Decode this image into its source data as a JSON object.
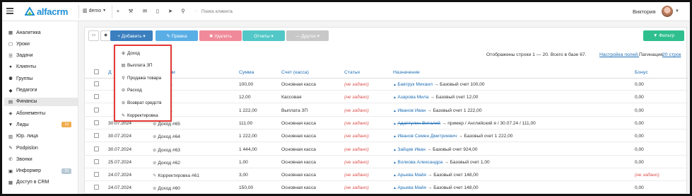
{
  "topbar": {
    "logo_text": "alfacrm",
    "branch": "demo",
    "search_placeholder": "Поиск клиента",
    "user_name": "Виктория",
    "brand_color": "#1f8fd6"
  },
  "sidebar": {
    "items": [
      {
        "label": "Аналитика",
        "icon": "chart-icon"
      },
      {
        "label": "Уроки",
        "icon": "calendar-icon"
      },
      {
        "label": "Задачи",
        "icon": "tasks-icon"
      },
      {
        "label": "Клиенты",
        "icon": "user-icon"
      },
      {
        "label": "Группы",
        "icon": "group-icon"
      },
      {
        "label": "Педагоги",
        "icon": "teacher-icon"
      },
      {
        "label": "Финансы",
        "icon": "money-icon",
        "active": true
      },
      {
        "label": "Абонементы",
        "icon": "ticket-icon"
      },
      {
        "label": "Лиды",
        "icon": "funnel-icon",
        "badge": "13"
      },
      {
        "label": "Юр. лица",
        "icon": "building-icon"
      },
      {
        "label": "Podpislon",
        "icon": "sign-icon"
      },
      {
        "label": "Звонки",
        "icon": "phone-icon"
      },
      {
        "label": "Информер",
        "icon": "info-icon",
        "badge": "15"
      },
      {
        "label": "Доступ в CRM",
        "icon": "lock-icon"
      }
    ]
  },
  "toolbar": {
    "add_label": "+ Добавить ▾",
    "edit_label": "✎ Правка",
    "delete_label": "✖ Удалить",
    "reports_label": "Отчеты ▾",
    "other_label": "— Другое ▾",
    "filter_label": "▼ Фильтр",
    "colors": {
      "add": "#3b7fbf",
      "edit": "#5aaee6",
      "delete": "#f08a9a",
      "reports": "#53c7c7",
      "other": "#c8c8c8",
      "filter": "#2fbf8f"
    }
  },
  "dropdown": {
    "items": [
      {
        "label": "Доход",
        "icon": "plus-circle-icon"
      },
      {
        "label": "Выплата ЗП",
        "icon": "cash-icon"
      },
      {
        "label": "Продажа товара",
        "icon": "cart-icon"
      },
      {
        "label": "Расход",
        "icon": "minus-circle-icon"
      },
      {
        "label": "Возврат средств",
        "icon": "minus-circle-icon"
      },
      {
        "label": "Корректировка",
        "icon": "pencil-icon"
      }
    ]
  },
  "info": {
    "shown_text": "Отображены строки 1 — 20. Всего в базе 67.",
    "settings_link": "Настройка полей.",
    "pagination_label": "Пагинация",
    "pagination_value": "20 строк"
  },
  "table": {
    "headers": [
      "Д",
      "Операции",
      "Сумма",
      "Счет (касса)",
      "Статья",
      "Назначение",
      "Бонус"
    ],
    "rows": [
      {
        "date": "",
        "op": "од #68",
        "sum": "100,00",
        "account": "Основная касса",
        "article": "(не задано)",
        "purpose_name": "Бавтрук Михаил",
        "purpose_rest": " → Базовый счет 100,00",
        "bonus": "0,00"
      },
      {
        "date": "",
        "op": "од #67",
        "sum": "12,00",
        "account": "Кассовая",
        "article": "(не задано)",
        "purpose_name": "Азарова Мила",
        "purpose_rest": " → Базовый счет 12,00",
        "bonus": "0,00"
      },
      {
        "date": "",
        "op": "од #66",
        "sum": "1 222,00",
        "account": "Выплата ЗП",
        "article": "(не задано)",
        "purpose_name": "Иванов Иван",
        "purpose_rest": " → Базовый счет 1 222,00",
        "bonus": "0,00"
      },
      {
        "date": "30.07.2024",
        "op": "Доход #65",
        "sum": "111,00",
        "account": "Основная касса",
        "article": "(не задано)",
        "purpose_name": "Адаптулин Виталий",
        "purpose_rest": " → пример / Английский я / 30.07.24 / 111,00",
        "bonus": "0,00",
        "strike": true
      },
      {
        "date": "30.07.2024",
        "op": "Доход #64",
        "sum": "1 222,00",
        "account": "Основная касса",
        "article": "(не задано)",
        "purpose_name": "Иванов Семен Дмитриевич",
        "purpose_rest": " → Базовый счет 1 222,00",
        "bonus": "0,00"
      },
      {
        "date": "30.07.2024",
        "op": "Доход #63",
        "sum": "1 444,00",
        "account": "Основная касса",
        "article": "(не задано)",
        "purpose_name": "Зайцев Иван",
        "purpose_rest": " → Базовый счет 924,00",
        "bonus": "0,00"
      },
      {
        "date": "25.07.2024",
        "op": "Доход #62",
        "sum": "1,00",
        "account": "Основная касса",
        "article": "(не задано)",
        "purpose_name": "Волкова Александра",
        "purpose_rest": " → Базовый счет 1,00",
        "bonus": "0,00"
      },
      {
        "date": "24.07.2024",
        "op": "Корректировка #61",
        "sum": "3,00",
        "account": "Основная касса",
        "article": "(не задано)",
        "purpose_name": "Арьева Майя",
        "purpose_rest": " → Базовый счет 148,00",
        "bonus": "(не задано)"
      },
      {
        "date": "24.07.2024",
        "op": "Доход #60",
        "sum": "150,00",
        "account": "Основная касса",
        "article": "(не задано)",
        "purpose_name": "Арьева Майя",
        "purpose_rest": " → Базовый счет 148,00",
        "bonus": "0,00"
      }
    ]
  }
}
